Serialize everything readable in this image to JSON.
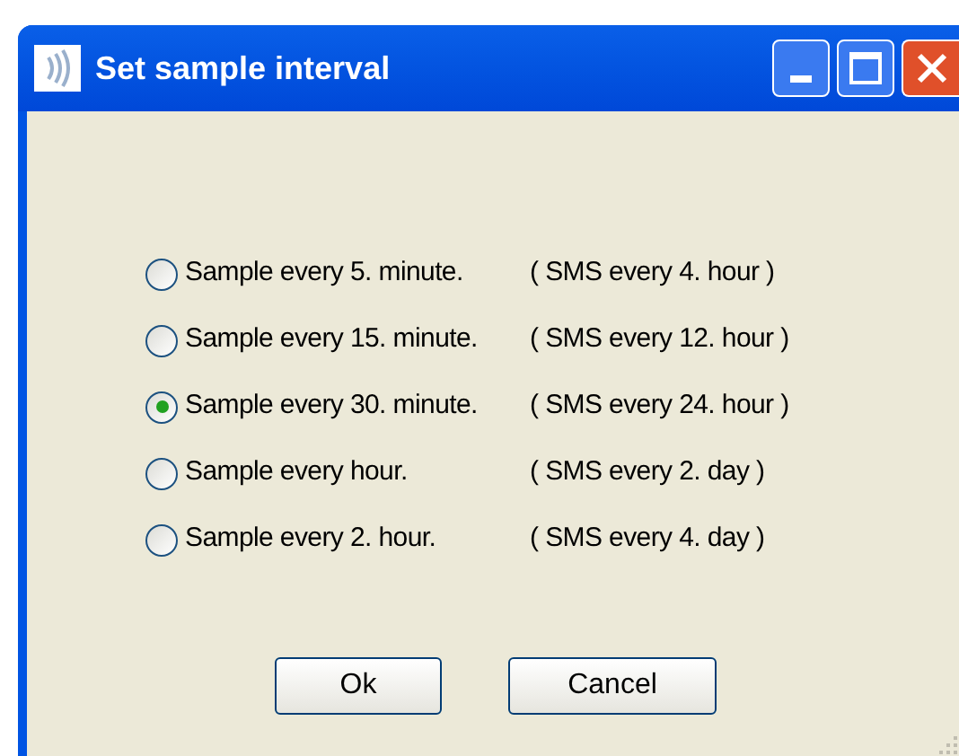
{
  "window": {
    "title": "Set sample interval"
  },
  "options": [
    {
      "sample": "Sample every 5. minute.",
      "sms": "( SMS every 4. hour )",
      "selected": false
    },
    {
      "sample": "Sample every 15. minute.",
      "sms": "( SMS every 12. hour )",
      "selected": false
    },
    {
      "sample": "Sample every 30. minute.",
      "sms": "( SMS every 24. hour )",
      "selected": true
    },
    {
      "sample": "Sample every hour.",
      "sms": "( SMS every 2. day )",
      "selected": false
    },
    {
      "sample": "Sample every 2. hour.",
      "sms": "( SMS every 4. day )",
      "selected": false
    }
  ],
  "buttons": [
    "Ok",
    "Cancel"
  ]
}
